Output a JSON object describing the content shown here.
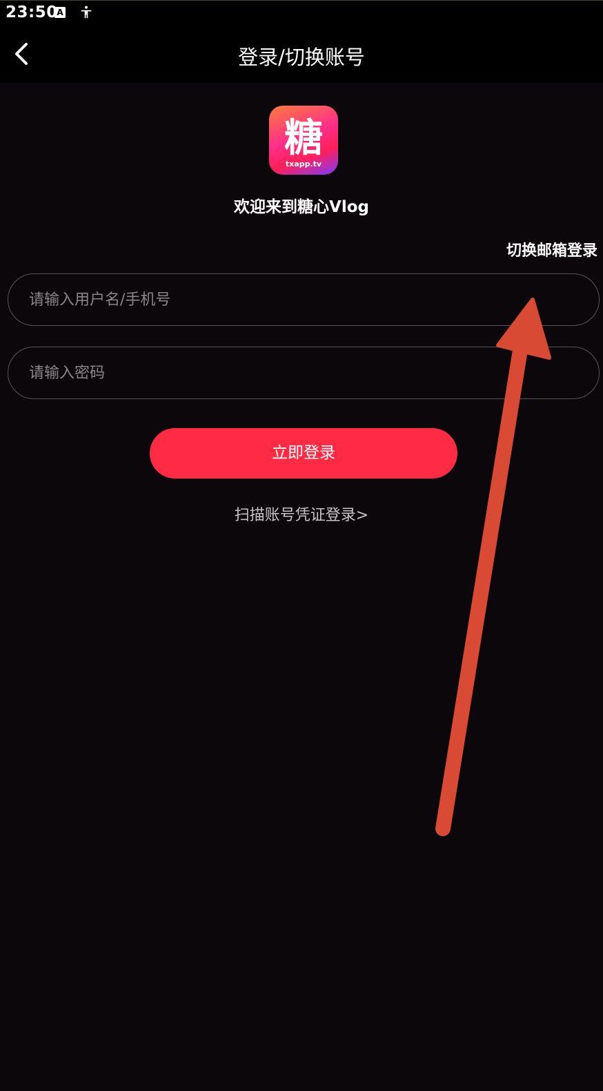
{
  "status_bar": {
    "time": "23:50",
    "icons": [
      "a-notification-icon",
      "accessibility-icon"
    ]
  },
  "header": {
    "title": "登录/切换账号",
    "back_icon": "chevron-left-icon"
  },
  "logo": {
    "char": "糖",
    "subtitle": "txapp.tv"
  },
  "welcome_text": "欢迎来到糖心Vlog",
  "switch_email_label": "切换邮箱登录",
  "form": {
    "username_placeholder": "请输入用户名/手机号",
    "password_placeholder": "请输入密码",
    "login_button": "立即登录",
    "scan_link": "扫描账号凭证登录>"
  },
  "colors": {
    "background": "#0c070a",
    "primary_button": "#ff2a44",
    "annotation_arrow": "#d94a35"
  }
}
